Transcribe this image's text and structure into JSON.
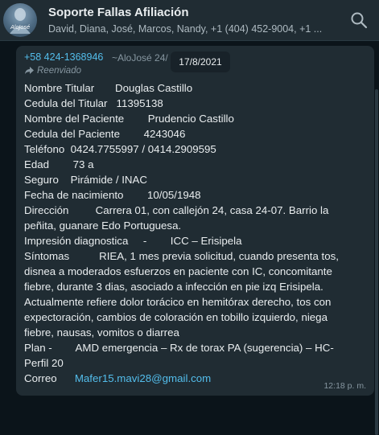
{
  "header": {
    "title": "Soporte Fallas Afiliación",
    "subtitle": "David, Diana, José, Marcos, Nandy, +1 (404) 452-9004, +1 ...",
    "avatar_text": "AloJosé",
    "search_icon": "search-icon"
  },
  "message": {
    "sender_phone": "+58 424-1368946",
    "sender_name": "~AloJosé 24/",
    "date_chip": "17/8/2021",
    "forwarded_label": "Reenviado",
    "lines": [
      "Nombre Titular       Douglas Castillo",
      "Cedula del Titular   11395138",
      "Nombre del Paciente        Prudencio Castillo",
      "Cedula del Paciente        4243046",
      "Teléfono  0424.7755997 / 0414.2909595",
      "Edad        73 a",
      "Seguro    Pirámide / INAC",
      "Fecha de nacimiento        10/05/1948",
      "Dirección         Carrera 01, con callejón 24, casa 24-07. Barrio la",
      "peñita, guanare Edo Portuguesa.",
      "Impresión diagnostica     -        ICC – Erisipela",
      "Síntomas          RIEA, 1 mes previa solicitud, cuando presenta tos,",
      "disnea a moderados esfuerzos en paciente con IC, concomitante",
      "fiebre, durante 3 dias, asociado a infección en pie izq Erisipela.",
      "Actualmente refiere dolor torácico en hemitórax derecho, tos con",
      "expectoración, cambios de coloración en tobillo izquierdo, niega",
      "fiebre, nausas, vomitos o diarrea",
      "Plan -        AMD emergencia – Rx de torax PA (sugerencia) – HC-",
      "Perfil 20"
    ],
    "email_label": "Correo",
    "email_value": "Mafer15.mavi28@gmail.com",
    "time": "12:18 p. m."
  },
  "colors": {
    "header_bg": "#202c33",
    "chat_bg": "#0b141a",
    "bubble_bg": "#202c33",
    "text": "#e9edef",
    "secondary_text": "#8696a0",
    "link": "#53bdeb"
  }
}
